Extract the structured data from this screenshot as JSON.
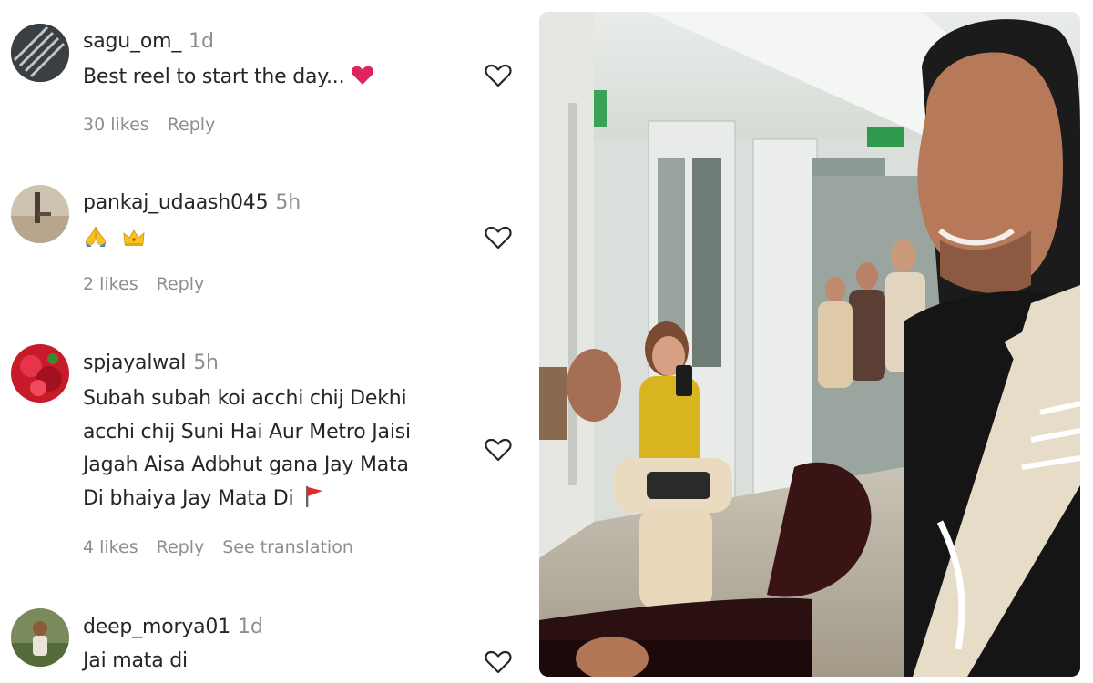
{
  "comments": [
    {
      "username": "sagu_om_",
      "time": "1d",
      "lines": [
        "Best reel to start the day..."
      ],
      "emoji": "red-heart",
      "likes": "30 likes",
      "reply": "Reply"
    },
    {
      "username": "pankaj_udaash045",
      "time": "5h",
      "lines": [],
      "emoji": "praying-hands, crown",
      "likes": "2 likes",
      "reply": "Reply"
    },
    {
      "username": "spjayalwal",
      "time": "5h",
      "lines": [
        "Subah subah koi acchi chij Dekhi",
        "acchi chij Suni Hai Aur Metro Jaisi",
        "Jagah Aisa Adbhut gana Jay Mata",
        "Di bhaiya Jay Mata Di"
      ],
      "emoji": "red-flag",
      "likes": "4 likes",
      "reply": "Reply",
      "translate": "See translation"
    },
    {
      "username": "deep_morya01",
      "time": "1d",
      "lines": [
        "Jai mata di"
      ]
    }
  ],
  "colors": {
    "text": "#262626",
    "muted": "#8e8e8e",
    "heart_red": "#e0245e"
  },
  "video": {
    "description": "Metro train interior with a smiling guitarist in the foreground and passengers seated behind"
  }
}
